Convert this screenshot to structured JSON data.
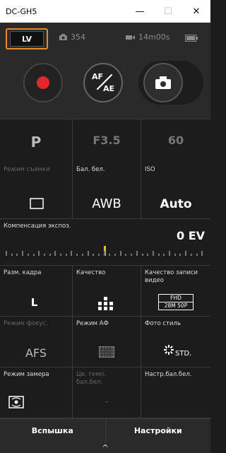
{
  "window": {
    "title": "DC-GH5",
    "minimize": "—",
    "maximize": "☐",
    "close": "✕"
  },
  "status": {
    "lv": "LV",
    "shots": "354",
    "rec_time": "14m00s"
  },
  "modes": {
    "af": "AF",
    "ae": "AE"
  },
  "exposure": {
    "mode": "P",
    "aperture": "F3.5",
    "shutter": "60"
  },
  "settings": {
    "shoot_mode_label": "Режим съемки",
    "wb_label": "Бал. бел.",
    "wb_value": "AWB",
    "iso_label": "ISO",
    "iso_value": "Auto",
    "exp_comp_label": "Компенсация экспоз.",
    "exp_comp_value": "0 EV",
    "frame_size_label": "Разм. кадра",
    "frame_size_value": "L",
    "quality_label": "Качество",
    "video_quality_label": "Качество записи видео",
    "video_fhd": "FHD",
    "video_spec": "28M 50P",
    "focus_mode_label": "Режим фокус.",
    "focus_mode_value": "AFS",
    "af_mode_label": "Режим АФ",
    "photo_style_label": "Фото стиль",
    "photo_style_value": "STD.",
    "metering_label": "Режим замера",
    "color_temp_label": "Цв. темп. бал.бел.",
    "color_temp_value": "-",
    "wb_adjust_label": "Настр.бал.бел."
  },
  "bottom": {
    "flash": "Вспышка",
    "settings": "Настройки",
    "handle": "^"
  },
  "colors": {
    "accent": "#e88a2a",
    "record": "#e0282c",
    "pointer": "#f0c020",
    "bg": "#1c1c1c"
  },
  "icons": [
    "camera-icon",
    "battery-icon",
    "video-icon",
    "record-icon",
    "af-ae-icon",
    "shutter-camera-icon",
    "square-frame-icon",
    "quality-dots-icon",
    "af-area-icon",
    "photo-style-icon",
    "metering-icon",
    "chevron-up-icon"
  ]
}
